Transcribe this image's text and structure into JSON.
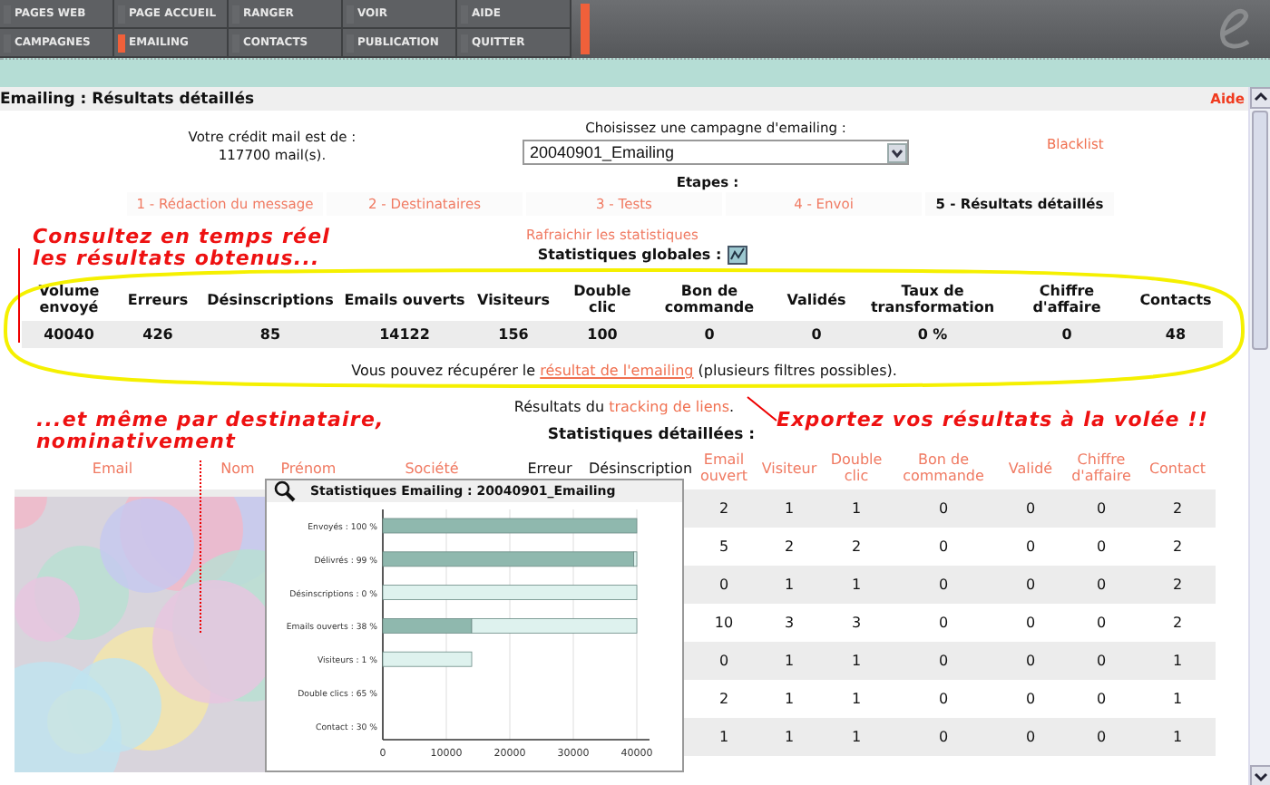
{
  "nav": {
    "rows": [
      [
        {
          "label": "PAGES WEB",
          "selected": false
        },
        {
          "label": "PAGE ACCUEIL",
          "selected": false
        },
        {
          "label": "RANGER",
          "selected": false
        },
        {
          "label": "VOIR",
          "selected": false
        },
        {
          "label": "AIDE",
          "selected": false
        }
      ],
      [
        {
          "label": "CAMPAGNES",
          "selected": false
        },
        {
          "label": "EMAILING",
          "selected": true
        },
        {
          "label": "CONTACTS",
          "selected": false
        },
        {
          "label": "PUBLICATION",
          "selected": false
        },
        {
          "label": "QUITTER",
          "selected": false
        }
      ]
    ]
  },
  "page": {
    "title": "Emailing : Résultats détaillés",
    "help": "Aide"
  },
  "credit": "Votre crédit mail est de : 117700 mail(s).",
  "campaign": {
    "label": "Choisissez une campagne d'emailing :",
    "value": "20040901_Emailing"
  },
  "blacklist": "Blacklist",
  "steps_label": "Etapes :",
  "steps": [
    {
      "label": "1 - Rédaction du message",
      "selected": false
    },
    {
      "label": "2 - Destinataires",
      "selected": false
    },
    {
      "label": "3 - Tests",
      "selected": false
    },
    {
      "label": "4 - Envoi",
      "selected": false
    },
    {
      "label": "5 - Résultats détaillés",
      "selected": true
    }
  ],
  "refresh": "Rafraichir les statistiques",
  "global_stats": {
    "title": "Statistiques globales :",
    "columns": [
      "Volume envoyé",
      "Erreurs",
      "Désinscriptions",
      "Emails ouverts",
      "Visiteurs",
      "Double clic",
      "Bon de commande",
      "Validés",
      "Taux de transformation",
      "Chiffre d'affaire",
      "Contacts"
    ],
    "values": [
      "40040",
      "426",
      "85",
      "14122",
      "156",
      "100",
      "0",
      "0",
      "0 %",
      "0",
      "48"
    ]
  },
  "export_text": {
    "before": "Vous pouvez récupérer le ",
    "link": "résultat de l'emailing",
    "after": " (plusieurs filtres possibles)."
  },
  "tracking_text": {
    "before": "Résultats du ",
    "link": "tracking de liens",
    "after": "."
  },
  "detailed": {
    "title": "Statistiques détaillées :",
    "columns": [
      "Email",
      "Nom",
      "Prénom",
      "Société",
      "Erreur",
      "Désinscription",
      "Email ouvert",
      "Visiteur",
      "Double clic",
      "Bon de commande",
      "Validé",
      "Chiffre d'affaire",
      "Contact"
    ],
    "rows": [
      [
        "",
        "",
        "",
        "",
        "",
        "",
        "2",
        "1",
        "1",
        "0",
        "0",
        "0",
        "2"
      ],
      [
        "",
        "",
        "",
        "",
        "",
        "",
        "5",
        "2",
        "2",
        "0",
        "0",
        "0",
        "2"
      ],
      [
        "",
        "",
        "",
        "",
        "",
        "",
        "0",
        "1",
        "1",
        "0",
        "0",
        "0",
        "2"
      ],
      [
        "",
        "",
        "",
        "",
        "",
        "",
        "10",
        "3",
        "3",
        "0",
        "0",
        "0",
        "2"
      ],
      [
        "",
        "",
        "",
        "",
        "",
        "",
        "0",
        "1",
        "1",
        "0",
        "0",
        "0",
        "1"
      ],
      [
        "",
        "",
        "",
        "",
        "",
        "",
        "2",
        "1",
        "1",
        "0",
        "0",
        "0",
        "1"
      ],
      [
        "",
        "",
        "",
        "",
        "",
        "",
        "1",
        "1",
        "1",
        "0",
        "0",
        "0",
        "1"
      ]
    ]
  },
  "popup": {
    "title": "Statistiques Emailing : 20040901_Emailing",
    "chart_data": {
      "type": "bar",
      "orientation": "horizontal",
      "categories": [
        "Envoyés : 100 %",
        "Délivrés : 99 %",
        "Désinscriptions : 0 %",
        "Emails ouverts : 38 %",
        "Visiteurs : 1 %",
        "Double clics : 65 %",
        "Contact : 30 %"
      ],
      "series": [
        {
          "color": "#8fb8ae",
          "values": [
            40000,
            39500,
            null,
            14000,
            null,
            null,
            null
          ]
        },
        {
          "color": "#def2ee",
          "values": [
            null,
            500,
            40000,
            26000,
            14000,
            null,
            null
          ]
        }
      ],
      "stacked": true,
      "grid": true,
      "xlim": [
        0,
        42000
      ],
      "xticks": [
        0,
        10000,
        20000,
        30000,
        40000
      ]
    }
  },
  "annotations": {
    "realtime": "Consultez en temps réel les résultats obtenus...",
    "export": "Exportez vos résultats à la volée !!",
    "recipient": "...et même par destinataire, nominativement"
  }
}
